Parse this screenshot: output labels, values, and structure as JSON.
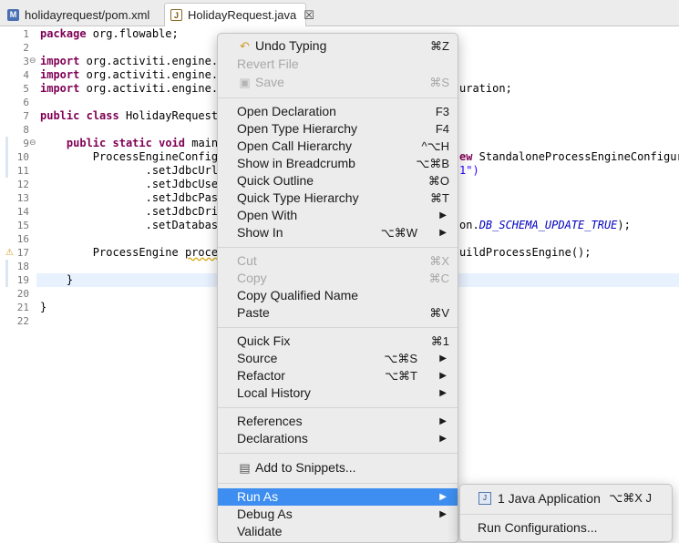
{
  "tabs": [
    {
      "label": "holidayrequest/pom.xml",
      "icon": "maven-file-icon",
      "active": false
    },
    {
      "label": "HolidayRequest.java",
      "icon": "java-file-icon",
      "active": true,
      "close": "☒"
    }
  ],
  "editor": {
    "line_numbers": [
      "1",
      "2",
      "3",
      "4",
      "5",
      "6",
      "7",
      "8",
      "9",
      "10",
      "11",
      "12",
      "13",
      "14",
      "15",
      "16",
      "17",
      "18",
      "19",
      "20",
      "21",
      "22"
    ],
    "fold_markers": {
      "line3": "⊖",
      "line9": "⊖"
    },
    "lines": [
      "package org.flowable;",
      "",
      "import org.activiti.engine.P",
      "import org.activiti.engine.P",
      "import org.activiti.engine.i",
      "",
      "public class HolidayRequest ",
      "",
      "    public static void main(",
      "        ProcessEngineConfigu",
      "                .setJdbcUrl(",
      "                .setJdbcUser",
      "                .setJdbcPass",
      "                .setJdbcDriv",
      "                .setDatabase",
      "",
      "        ProcessEngine proces",
      "",
      "    }",
      "",
      "}",
      ""
    ],
    "right_fragments": {
      "line5": "uration;",
      "line10_kw": "ew",
      "line10": " StandaloneProcessEngineConfigura",
      "line11": "1\")",
      "line15_prefix": "on.",
      "line15_const": "DB_SCHEMA_UPDATE_TRUE",
      "line15_suffix": ");",
      "line17": "uildProcessEngine();"
    }
  },
  "context_menu": {
    "groups": [
      [
        {
          "label": "Undo Typing",
          "shortcut": "⌘Z",
          "icon": "undo-icon",
          "disabled": false
        },
        {
          "label": "Revert File",
          "shortcut": "",
          "disabled": true
        },
        {
          "label": "Save",
          "shortcut": "⌘S",
          "icon": "save-icon",
          "disabled": true
        }
      ],
      [
        {
          "label": "Open Declaration",
          "shortcut": "F3"
        },
        {
          "label": "Open Type Hierarchy",
          "shortcut": "F4"
        },
        {
          "label": "Open Call Hierarchy",
          "shortcut": "^⌥H"
        },
        {
          "label": "Show in Breadcrumb",
          "shortcut": "⌥⌘B"
        },
        {
          "label": "Quick Outline",
          "shortcut": "⌘O"
        },
        {
          "label": "Quick Type Hierarchy",
          "shortcut": "⌘T"
        },
        {
          "label": "Open With",
          "shortcut": "",
          "submenu": true
        },
        {
          "label": "Show In",
          "shortcut": "⌥⌘W",
          "submenu": true
        }
      ],
      [
        {
          "label": "Cut",
          "shortcut": "⌘X",
          "disabled": true
        },
        {
          "label": "Copy",
          "shortcut": "⌘C",
          "disabled": true
        },
        {
          "label": "Copy Qualified Name",
          "shortcut": ""
        },
        {
          "label": "Paste",
          "shortcut": "⌘V"
        }
      ],
      [
        {
          "label": "Quick Fix",
          "shortcut": "⌘1"
        },
        {
          "label": "Source",
          "shortcut": "⌥⌘S",
          "submenu": true
        },
        {
          "label": "Refactor",
          "shortcut": "⌥⌘T",
          "submenu": true
        },
        {
          "label": "Local History",
          "shortcut": "",
          "submenu": true
        }
      ],
      [
        {
          "label": "References",
          "submenu": true
        },
        {
          "label": "Declarations",
          "submenu": true
        }
      ],
      [
        {
          "label": "Add to Snippets...",
          "icon": "snippets-icon"
        }
      ],
      [
        {
          "label": "Run As",
          "submenu": true,
          "selected": true
        },
        {
          "label": "Debug As",
          "submenu": true
        },
        {
          "label": "Validate"
        }
      ]
    ],
    "submenu_arrow": "▶"
  },
  "run_as_submenu": {
    "items": [
      {
        "label": "1 Java Application",
        "shortcut": "⌥⌘X J",
        "icon": "java-application-icon"
      },
      {
        "label": "Run Configurations..."
      }
    ]
  },
  "colors": {
    "selection": "#3d8ef0",
    "keyword": "#7f0055",
    "string": "#2a00ff",
    "constant": "#0000c0"
  }
}
